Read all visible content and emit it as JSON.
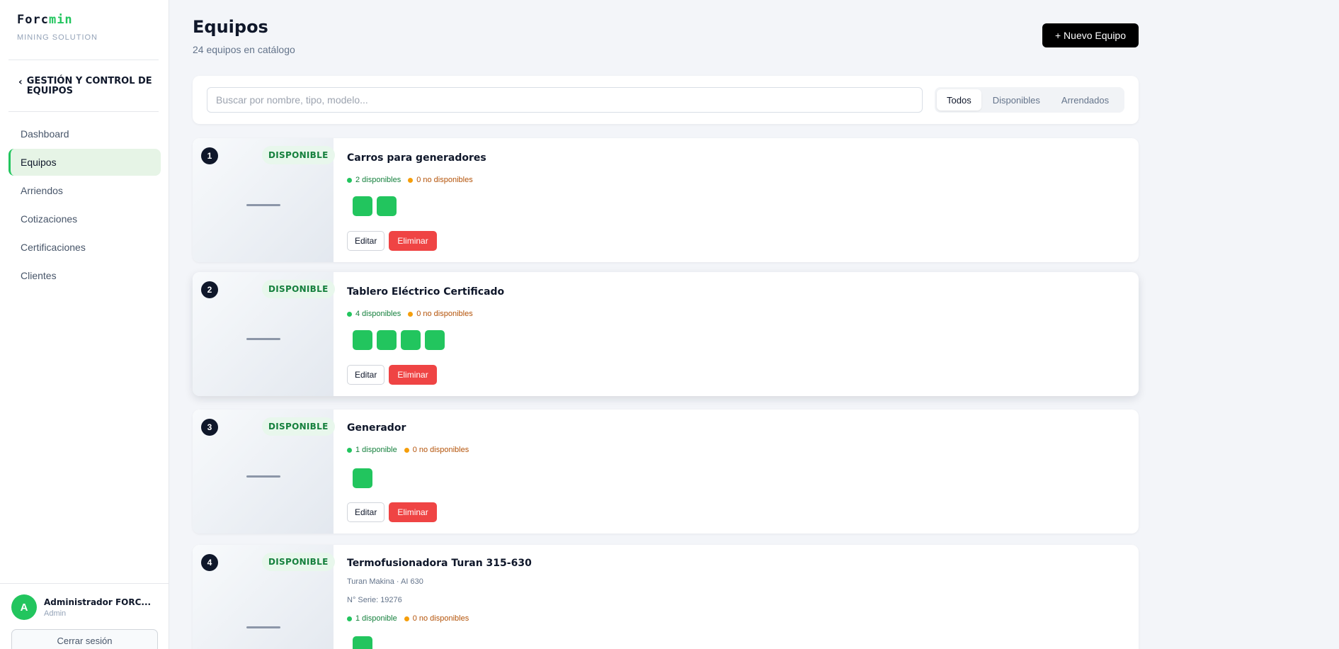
{
  "brand": {
    "logo_main": "Forc",
    "logo_accent": "min",
    "subtitle": "MINING SOLUTION"
  },
  "sidebar": {
    "section_title": "GESTIÓN Y CONTROL DE EQUIPOS",
    "items": [
      {
        "label": "Dashboard"
      },
      {
        "label": "Equipos",
        "active": true
      },
      {
        "label": "Arriendos"
      },
      {
        "label": "Cotizaciones"
      },
      {
        "label": "Certificaciones"
      },
      {
        "label": "Clientes"
      }
    ],
    "user": {
      "initial": "A",
      "name": "Administrador FORC...",
      "role": "Admin"
    },
    "logout_label": "Cerrar sesión"
  },
  "header": {
    "title": "Equipos",
    "subtitle": "24 equipos en catálogo",
    "new_button": "+ Nuevo Equipo"
  },
  "filters": {
    "search_placeholder": "Buscar por nombre, tipo, modelo...",
    "search_value": "",
    "tabs": [
      {
        "label": "Todos",
        "active": true
      },
      {
        "label": "Disponibles"
      },
      {
        "label": "Arrendados"
      }
    ]
  },
  "colors": {
    "accent": "#22c55e",
    "danger": "#ef4444",
    "warning": "#f59e0b",
    "dark": "#0f172a"
  },
  "equipment": [
    {
      "number": "1",
      "status": "DISPONIBLE",
      "name": "Carros para generadores",
      "available_text": "2 disponibles",
      "unavailable_text": "0 no disponibles",
      "units": 2,
      "edit_label": "Editar",
      "delete_label": "Eliminar"
    },
    {
      "number": "2",
      "status": "DISPONIBLE",
      "name": "Tablero Eléctrico Certificado",
      "available_text": "4 disponibles",
      "unavailable_text": "0 no disponibles",
      "units": 4,
      "edit_label": "Editar",
      "delete_label": "Eliminar"
    },
    {
      "number": "3",
      "status": "DISPONIBLE",
      "name": "Generador",
      "available_text": "1 disponible",
      "unavailable_text": "0 no disponibles",
      "units": 1,
      "edit_label": "Editar",
      "delete_label": "Eliminar"
    },
    {
      "number": "4",
      "status": "DISPONIBLE",
      "name": "Termofusionadora Turan 315-630",
      "brand_model": "Turan Makina · AI 630",
      "serial": "N° Serie: 19276",
      "available_text": "1 disponible",
      "unavailable_text": "0 no disponibles",
      "units": 1
    }
  ]
}
